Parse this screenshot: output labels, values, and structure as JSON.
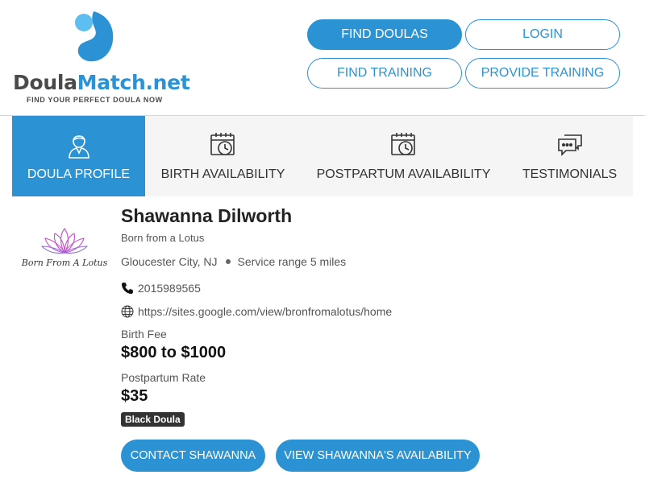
{
  "brand": {
    "name_part1": "Doula",
    "name_part2": "Match.net",
    "tagline": "FIND YOUR PERFECT DOULA NOW",
    "accent_color": "#2b93d4",
    "light_accent_color": "#5fbef0"
  },
  "nav": {
    "find_doulas": "FIND DOULAS",
    "login": "LOGIN",
    "find_training": "FIND TRAINING",
    "provide_training": "PROVIDE TRAINING"
  },
  "tabs": [
    {
      "label": "DOULA PROFILE",
      "icon": "doula-person-icon",
      "active": true
    },
    {
      "label": "BIRTH AVAILABILITY",
      "icon": "calendar-clock-icon",
      "active": false
    },
    {
      "label": "POSTPARTUM AVAILABILITY",
      "icon": "calendar-clock-icon",
      "active": false
    },
    {
      "label": "TESTIMONIALS",
      "icon": "chat-bubbles-icon",
      "active": false
    }
  ],
  "profile": {
    "logo_text": "Born From A Lotus",
    "name": "Shawanna Dilworth",
    "business": "Born from a Lotus",
    "location": "Gloucester City, NJ",
    "service_range": "Service range 5 miles",
    "phone": "2015989565",
    "website": "https://sites.google.com/view/bronfromalotus/home",
    "birth_fee_label": "Birth Fee",
    "birth_fee": "$800 to $1000",
    "postpartum_label": "Postpartum Rate",
    "postpartum_rate": "$35",
    "badge": "Black Doula",
    "contact_button": "CONTACT SHAWANNA",
    "availability_button": "VIEW SHAWANNA'S AVAILABILITY"
  }
}
